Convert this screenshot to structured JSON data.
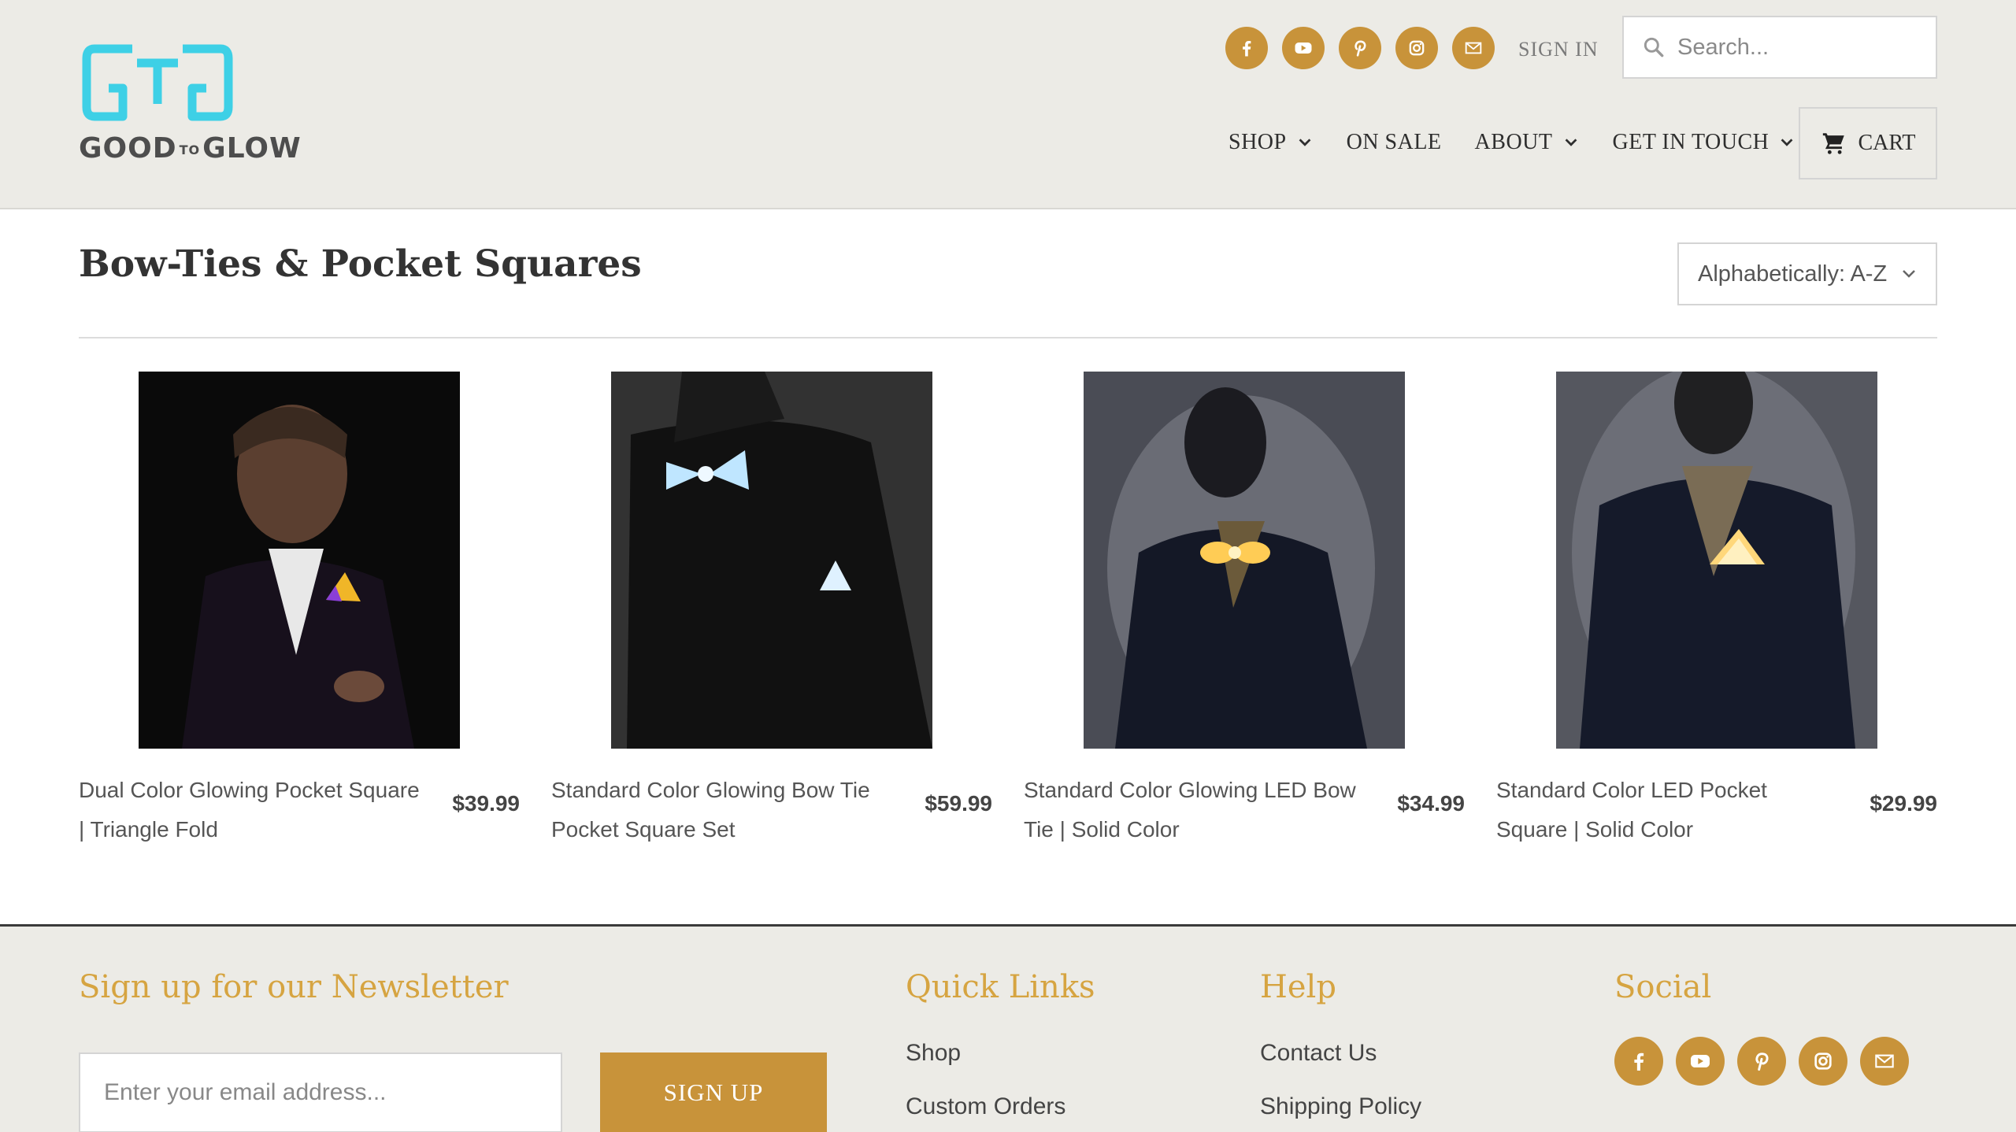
{
  "brand": {
    "logo_text_left": "GOOD",
    "logo_text_mid": "TO",
    "logo_text_right": "GLOW",
    "accent_color": "#c8933a",
    "logo_color": "#3ed0e6"
  },
  "header": {
    "social_icons": [
      "facebook-icon",
      "youtube-icon",
      "pinterest-icon",
      "instagram-icon",
      "mail-icon"
    ],
    "sign_in": "SIGN IN",
    "search_placeholder": "Search...",
    "nav": {
      "shop": "SHOP",
      "on_sale": "ON SALE",
      "about": "ABOUT",
      "get_in_touch": "GET IN TOUCH"
    },
    "cart": "CART"
  },
  "collection": {
    "title": "Bow-Ties & Pocket Squares",
    "sort_selected": "Alphabetically: A-Z"
  },
  "products": [
    {
      "name": "Dual Color Glowing Pocket Square | Triangle Fold",
      "price": "$39.99"
    },
    {
      "name": "Standard Color Glowing Bow Tie Pocket Square Set",
      "price": "$59.99"
    },
    {
      "name": "Standard Color Glowing LED Bow Tie | Solid Color",
      "price": "$34.99"
    },
    {
      "name": "Standard Color LED Pocket Square | Solid Color",
      "price": "$29.99"
    }
  ],
  "footer": {
    "newsletter_heading": "Sign up for our Newsletter",
    "email_placeholder": "Enter your email address...",
    "signup_button": "SIGN UP",
    "quick_links_heading": "Quick Links",
    "quick_links": [
      "Shop",
      "Custom Orders"
    ],
    "help_heading": "Help",
    "help_links": [
      "Contact Us",
      "Shipping Policy"
    ],
    "social_heading": "Social",
    "heading_color": "#d6a441"
  }
}
